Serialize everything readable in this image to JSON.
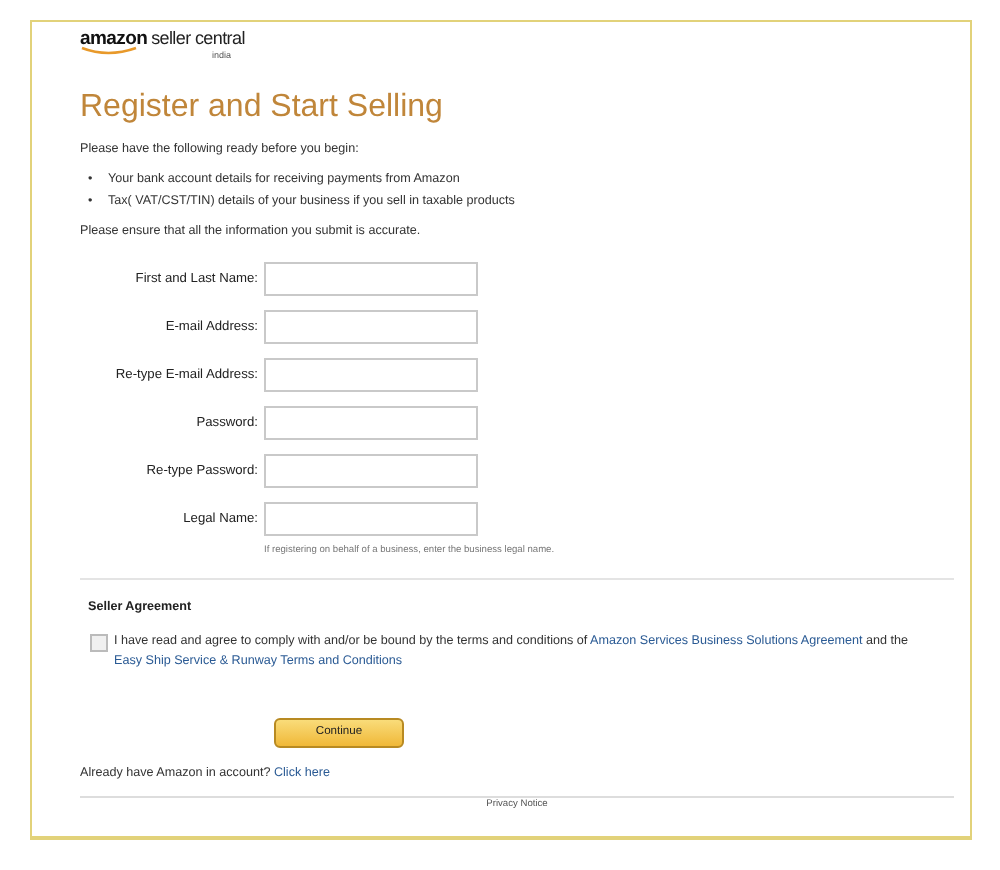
{
  "logo": {
    "brand": "amazon",
    "product": "seller central",
    "region": "india"
  },
  "title": "Register and Start Selling",
  "intro": "Please have the following ready before you begin:",
  "requirements": [
    {
      "bullet": "•",
      "text": "Your bank account details for receiving payments from Amazon"
    },
    {
      "bullet": "•",
      "text": "Tax( VAT/CST/TIN) details of your business if you sell in taxable products"
    }
  ],
  "accuracy_note": "Please ensure that all the information you submit is accurate.",
  "fields": [
    {
      "label": "First and Last Name:"
    },
    {
      "label": "E-mail Address:"
    },
    {
      "label": "Re-type E-mail Address:"
    },
    {
      "label": "Password:"
    },
    {
      "label": "Re-type Password:"
    },
    {
      "label": "Legal Name:",
      "hint": "If registering on behalf of a business, enter the business legal name."
    }
  ],
  "seller_agreement": {
    "heading": "Seller Agreement",
    "checked": false,
    "text_before": "I have read and agree to comply with and/or be bound by the terms and conditions of",
    "link_1": "Amazon Services Business Solutions Agreement",
    "text_middle": "and the",
    "link_2": "Easy Ship Service & Runway Terms and Conditions"
  },
  "continue_button": "Continue",
  "signin": {
    "text": "Already have Amazon in account?",
    "link": "Click here"
  },
  "footer": "Privacy Notice"
}
